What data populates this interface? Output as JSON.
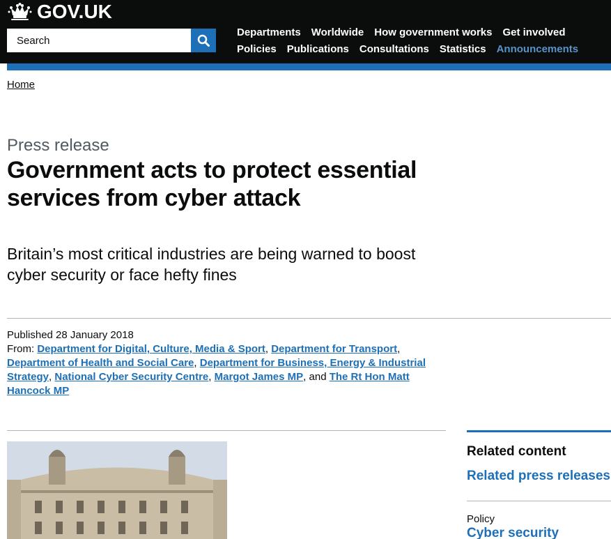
{
  "header": {
    "logo_text": "GOV.UK",
    "search": {
      "placeholder": "Search"
    },
    "nav_row1": [
      "Departments",
      "Worldwide",
      "How government works",
      "Get involved"
    ],
    "nav_row2": [
      "Policies",
      "Publications",
      "Consultations",
      "Statistics",
      "Announcements"
    ],
    "active_item": "Announcements"
  },
  "breadcrumb": {
    "home": "Home"
  },
  "article": {
    "doc_type": "Press release",
    "title": "Government acts to protect essential services from cyber attack",
    "lead": "Britain’s most critical industries are being warned to boost cyber security or face hefty fines",
    "published": "Published 28 January 2018",
    "from_label": "From:",
    "from": [
      "Department for Digital, Culture, Media & Sport",
      "Department for Transport",
      "Department of Health and Social Care",
      "Department for Business, Energy & Industrial Strategy",
      "National Cyber Security Centre",
      "Margot James MP",
      "The Rt Hon Matt Hancock MP"
    ],
    "and_word": ", and"
  },
  "related": {
    "heading": "Related content",
    "press_link": "Related press releases",
    "policy_label": "Policy",
    "policy_link": "Cyber security"
  },
  "colors": {
    "header_bg": "#0b0c0c",
    "link_blue": "#1d70b8",
    "active_nav": "#5694ca"
  }
}
